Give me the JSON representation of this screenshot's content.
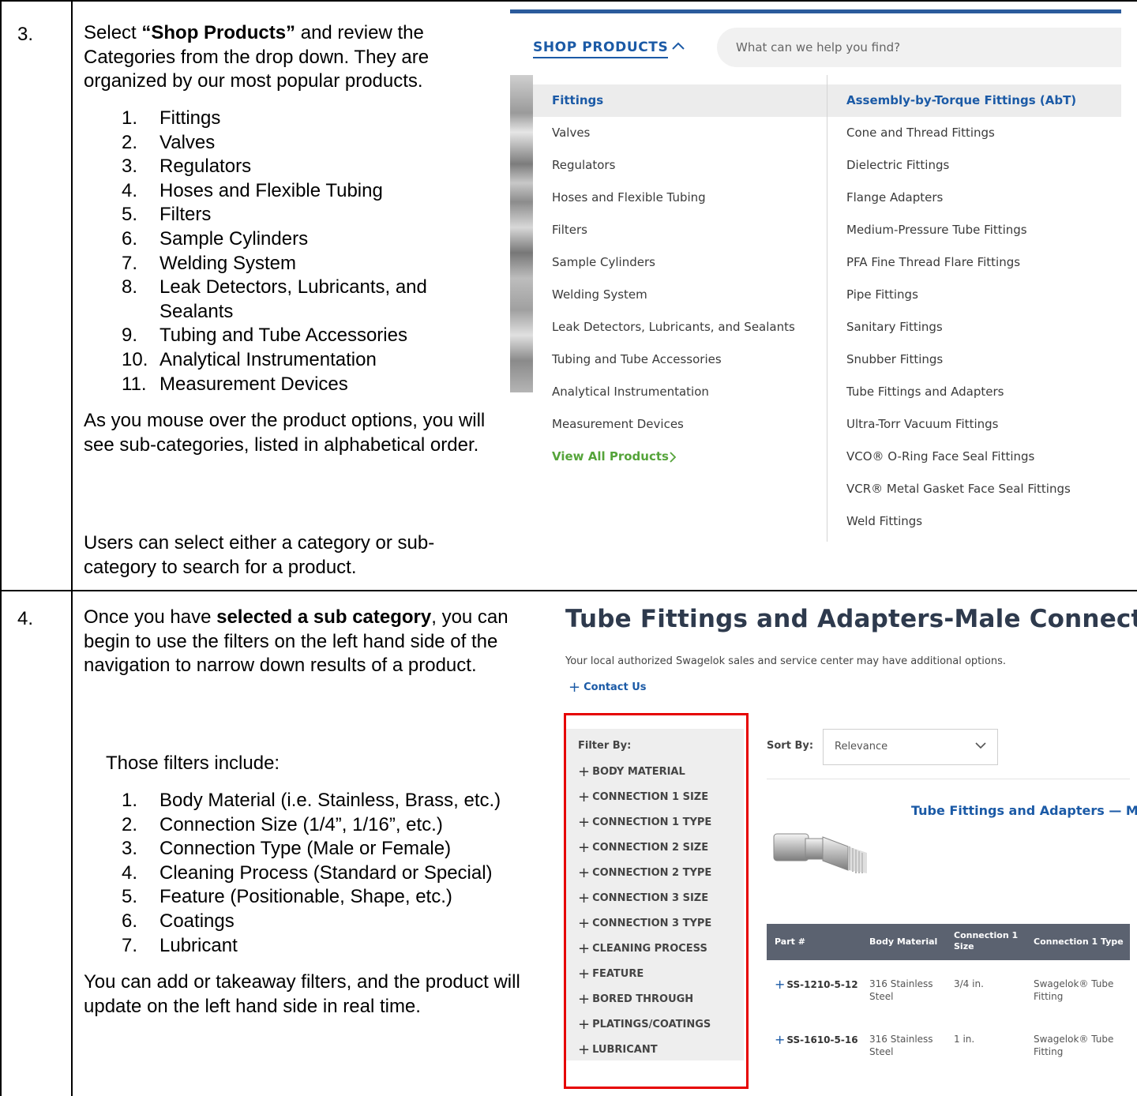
{
  "step3": {
    "number": "3.",
    "intro_pre": "Select ",
    "intro_bold": "“Shop Products”",
    "intro_post": " and review the Categories from the drop down. They are organized by our most popular products.",
    "list": [
      {
        "n": "1.",
        "t": "Fittings"
      },
      {
        "n": "2.",
        "t": "Valves"
      },
      {
        "n": "3.",
        "t": "Regulators"
      },
      {
        "n": "4.",
        "t": "Hoses and Flexible Tubing"
      },
      {
        "n": "5.",
        "t": "Filters"
      },
      {
        "n": "6.",
        "t": "Sample Cylinders"
      },
      {
        "n": "7.",
        "t": "Welding System"
      },
      {
        "n": "8.",
        "t": "Leak Detectors, Lubricants, and Sealants"
      },
      {
        "n": "9.",
        "t": "Tubing and Tube Accessories"
      },
      {
        "n": "10.",
        "t": "Analytical Instrumentation"
      },
      {
        "n": "11.",
        "t": "Measurement Devices"
      }
    ],
    "mouseover_text": " As you mouse over the product options, you will see sub-categories, listed in alphabetical order.",
    "select_text": "Users can select either a category or sub-category to search for a product."
  },
  "step4": {
    "number": "4.",
    "intro_pre": "Once you have ",
    "intro_bold": "selected a sub category",
    "intro_post": ", you can begin to use the filters on the left hand side of the navigation to narrow down results of a product.",
    "filters_intro": "Those filters include:",
    "list": [
      {
        "n": "1.",
        "t": "Body Material (i.e. Stainless, Brass, etc.)"
      },
      {
        "n": "2.",
        "t": "Connection Size (1/4”, 1/16”, etc.)"
      },
      {
        "n": "3.",
        "t": "Connection Type (Male or Female)"
      },
      {
        "n": "4.",
        "t": "Cleaning Process (Standard or Special)"
      },
      {
        "n": "5.",
        "t": "Feature (Positionable, Shape, etc.)"
      },
      {
        "n": "6.",
        "t": "Coatings"
      },
      {
        "n": "7.",
        "t": "Lubricant"
      }
    ],
    "outro": "You can add or takeaway filters, and the product will update on the left hand side in real time."
  },
  "shop_menu": {
    "shop_label": "SHOP PRODUCTS",
    "search_placeholder": "What can we help you find?",
    "categories": [
      "Fittings",
      "Valves",
      "Regulators",
      "Hoses and Flexible Tubing",
      "Filters",
      "Sample Cylinders",
      "Welding System",
      "Leak Detectors, Lubricants, and Sealants",
      "Tubing and Tube Accessories",
      "Analytical Instrumentation",
      "Measurement Devices"
    ],
    "view_all": "View All Products",
    "subcategories": [
      "Assembly-by-Torque Fittings (AbT)",
      "Cone and Thread Fittings",
      "Dielectric Fittings",
      "Flange Adapters",
      "Medium-Pressure Tube Fittings",
      "PFA Fine Thread Flare Fittings",
      "Pipe Fittings",
      "Sanitary Fittings",
      "Snubber Fittings",
      "Tube Fittings and Adapters",
      "Ultra-Torr Vacuum Fittings",
      "VCO® O-Ring Face Seal Fittings",
      "VCR® Metal Gasket Face Seal Fittings",
      "Weld Fittings"
    ],
    "brand_color": "#1b5aa6",
    "view_all_color": "#55a43a"
  },
  "product_page": {
    "title": "Tube Fittings and Adapters-Male Connectors",
    "subtitle": "Your local authorized Swagelok sales and service center may have additional options.",
    "contact": "Contact Us",
    "filter_by": "Filter By:",
    "filters": [
      "BODY MATERIAL",
      "CONNECTION 1 SIZE",
      "CONNECTION 1 TYPE",
      "CONNECTION 2 SIZE",
      "CONNECTION 2 TYPE",
      "CONNECTION 3 SIZE",
      "CONNECTION 3 TYPE",
      "CLEANING PROCESS",
      "FEATURE",
      "BORED THROUGH",
      "PLATINGS/COATINGS",
      "LUBRICANT"
    ],
    "sort_by": "Sort By:",
    "sort_value": "Relevance",
    "product_heading": "Tube Fittings and Adapters — M",
    "columns": {
      "part": "Part #",
      "body": "Body Material",
      "conn1_size_a": "Connection 1",
      "conn1_size_b": "Size",
      "conn1_type": "Connection 1 Type"
    },
    "rows": [
      {
        "part": "SS-1210-5-12",
        "body_a": "316 Stainless",
        "body_b": "Steel",
        "size": "3/4 in.",
        "type_a": "Swagelok® Tube",
        "type_b": "Fitting"
      },
      {
        "part": "SS-1610-5-16",
        "body_a": "316 Stainless",
        "body_b": "Steel",
        "size": "1 in.",
        "type_a": "Swagelok® Tube",
        "type_b": "Fitting"
      }
    ],
    "highlight_color": "#e60000"
  }
}
